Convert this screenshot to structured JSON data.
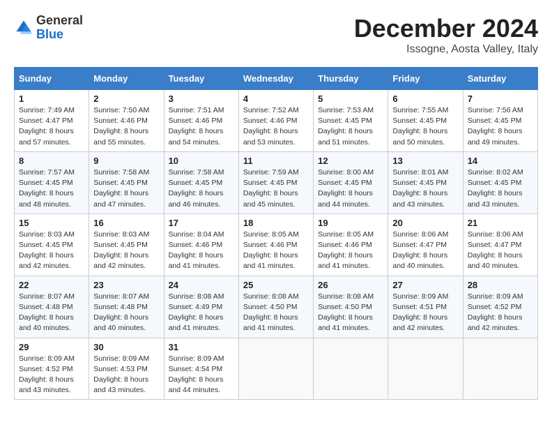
{
  "logo": {
    "general": "General",
    "blue": "Blue"
  },
  "header": {
    "month": "December 2024",
    "location": "Issogne, Aosta Valley, Italy"
  },
  "weekdays": [
    "Sunday",
    "Monday",
    "Tuesday",
    "Wednesday",
    "Thursday",
    "Friday",
    "Saturday"
  ],
  "weeks": [
    [
      {
        "day": 1,
        "sunrise": "7:49 AM",
        "sunset": "4:47 PM",
        "daylight": "8 hours and 57 minutes."
      },
      {
        "day": 2,
        "sunrise": "7:50 AM",
        "sunset": "4:46 PM",
        "daylight": "8 hours and 55 minutes."
      },
      {
        "day": 3,
        "sunrise": "7:51 AM",
        "sunset": "4:46 PM",
        "daylight": "8 hours and 54 minutes."
      },
      {
        "day": 4,
        "sunrise": "7:52 AM",
        "sunset": "4:46 PM",
        "daylight": "8 hours and 53 minutes."
      },
      {
        "day": 5,
        "sunrise": "7:53 AM",
        "sunset": "4:45 PM",
        "daylight": "8 hours and 51 minutes."
      },
      {
        "day": 6,
        "sunrise": "7:55 AM",
        "sunset": "4:45 PM",
        "daylight": "8 hours and 50 minutes."
      },
      {
        "day": 7,
        "sunrise": "7:56 AM",
        "sunset": "4:45 PM",
        "daylight": "8 hours and 49 minutes."
      }
    ],
    [
      {
        "day": 8,
        "sunrise": "7:57 AM",
        "sunset": "4:45 PM",
        "daylight": "8 hours and 48 minutes."
      },
      {
        "day": 9,
        "sunrise": "7:58 AM",
        "sunset": "4:45 PM",
        "daylight": "8 hours and 47 minutes."
      },
      {
        "day": 10,
        "sunrise": "7:58 AM",
        "sunset": "4:45 PM",
        "daylight": "8 hours and 46 minutes."
      },
      {
        "day": 11,
        "sunrise": "7:59 AM",
        "sunset": "4:45 PM",
        "daylight": "8 hours and 45 minutes."
      },
      {
        "day": 12,
        "sunrise": "8:00 AM",
        "sunset": "4:45 PM",
        "daylight": "8 hours and 44 minutes."
      },
      {
        "day": 13,
        "sunrise": "8:01 AM",
        "sunset": "4:45 PM",
        "daylight": "8 hours and 43 minutes."
      },
      {
        "day": 14,
        "sunrise": "8:02 AM",
        "sunset": "4:45 PM",
        "daylight": "8 hours and 43 minutes."
      }
    ],
    [
      {
        "day": 15,
        "sunrise": "8:03 AM",
        "sunset": "4:45 PM",
        "daylight": "8 hours and 42 minutes."
      },
      {
        "day": 16,
        "sunrise": "8:03 AM",
        "sunset": "4:45 PM",
        "daylight": "8 hours and 42 minutes."
      },
      {
        "day": 17,
        "sunrise": "8:04 AM",
        "sunset": "4:46 PM",
        "daylight": "8 hours and 41 minutes."
      },
      {
        "day": 18,
        "sunrise": "8:05 AM",
        "sunset": "4:46 PM",
        "daylight": "8 hours and 41 minutes."
      },
      {
        "day": 19,
        "sunrise": "8:05 AM",
        "sunset": "4:46 PM",
        "daylight": "8 hours and 41 minutes."
      },
      {
        "day": 20,
        "sunrise": "8:06 AM",
        "sunset": "4:47 PM",
        "daylight": "8 hours and 40 minutes."
      },
      {
        "day": 21,
        "sunrise": "8:06 AM",
        "sunset": "4:47 PM",
        "daylight": "8 hours and 40 minutes."
      }
    ],
    [
      {
        "day": 22,
        "sunrise": "8:07 AM",
        "sunset": "4:48 PM",
        "daylight": "8 hours and 40 minutes."
      },
      {
        "day": 23,
        "sunrise": "8:07 AM",
        "sunset": "4:48 PM",
        "daylight": "8 hours and 40 minutes."
      },
      {
        "day": 24,
        "sunrise": "8:08 AM",
        "sunset": "4:49 PM",
        "daylight": "8 hours and 41 minutes."
      },
      {
        "day": 25,
        "sunrise": "8:08 AM",
        "sunset": "4:50 PM",
        "daylight": "8 hours and 41 minutes."
      },
      {
        "day": 26,
        "sunrise": "8:08 AM",
        "sunset": "4:50 PM",
        "daylight": "8 hours and 41 minutes."
      },
      {
        "day": 27,
        "sunrise": "8:09 AM",
        "sunset": "4:51 PM",
        "daylight": "8 hours and 42 minutes."
      },
      {
        "day": 28,
        "sunrise": "8:09 AM",
        "sunset": "4:52 PM",
        "daylight": "8 hours and 42 minutes."
      }
    ],
    [
      {
        "day": 29,
        "sunrise": "8:09 AM",
        "sunset": "4:52 PM",
        "daylight": "8 hours and 43 minutes."
      },
      {
        "day": 30,
        "sunrise": "8:09 AM",
        "sunset": "4:53 PM",
        "daylight": "8 hours and 43 minutes."
      },
      {
        "day": 31,
        "sunrise": "8:09 AM",
        "sunset": "4:54 PM",
        "daylight": "8 hours and 44 minutes."
      },
      null,
      null,
      null,
      null
    ]
  ]
}
